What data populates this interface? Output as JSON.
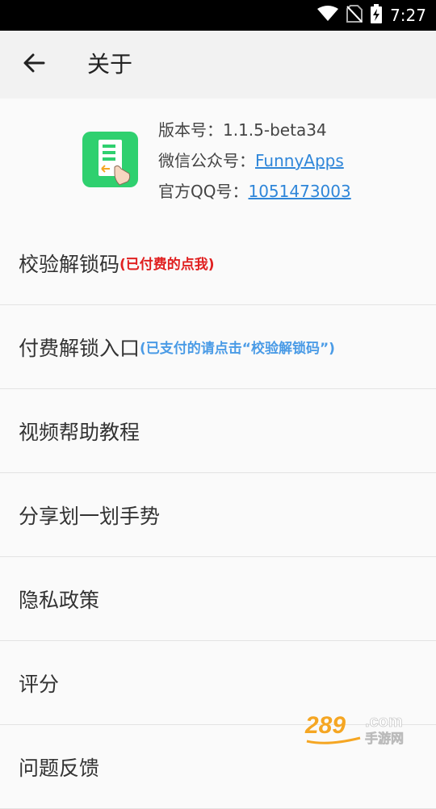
{
  "status_bar": {
    "time": "7:27",
    "icons": [
      "wifi-icon",
      "no-sim-icon",
      "battery-charging-icon"
    ]
  },
  "app_bar": {
    "title": "关于",
    "back_icon": "arrow-left-icon"
  },
  "app_info": {
    "app_icon": "app-logo-icon",
    "version_label": "版本号：",
    "version_value": "1.1.5-beta34",
    "wechat_label": "微信公众号：",
    "wechat_value": "FunnyApps",
    "qq_label": "官方QQ号：",
    "qq_value": "1051473003",
    "link_color": "#2f86d9"
  },
  "menu": {
    "items": [
      {
        "label": "校验解锁码",
        "note": "(已付费的点我)",
        "note_color": "#e02020"
      },
      {
        "label": "付费解锁入口",
        "note": "(已支付的请点击“校验解锁码”)",
        "note_color": "#4a9be6"
      },
      {
        "label": "视频帮助教程"
      },
      {
        "label": "分享划一划手势"
      },
      {
        "label": "隐私政策"
      },
      {
        "label": "评分"
      },
      {
        "label": "问题反馈"
      }
    ]
  },
  "watermark": {
    "main": "289.com",
    "sub": "手游网"
  },
  "colors": {
    "status_bar_bg": "#000000",
    "app_bar_bg": "#f2f2f2",
    "page_bg": "#fafafa",
    "app_icon_green": "#2fd06f"
  }
}
